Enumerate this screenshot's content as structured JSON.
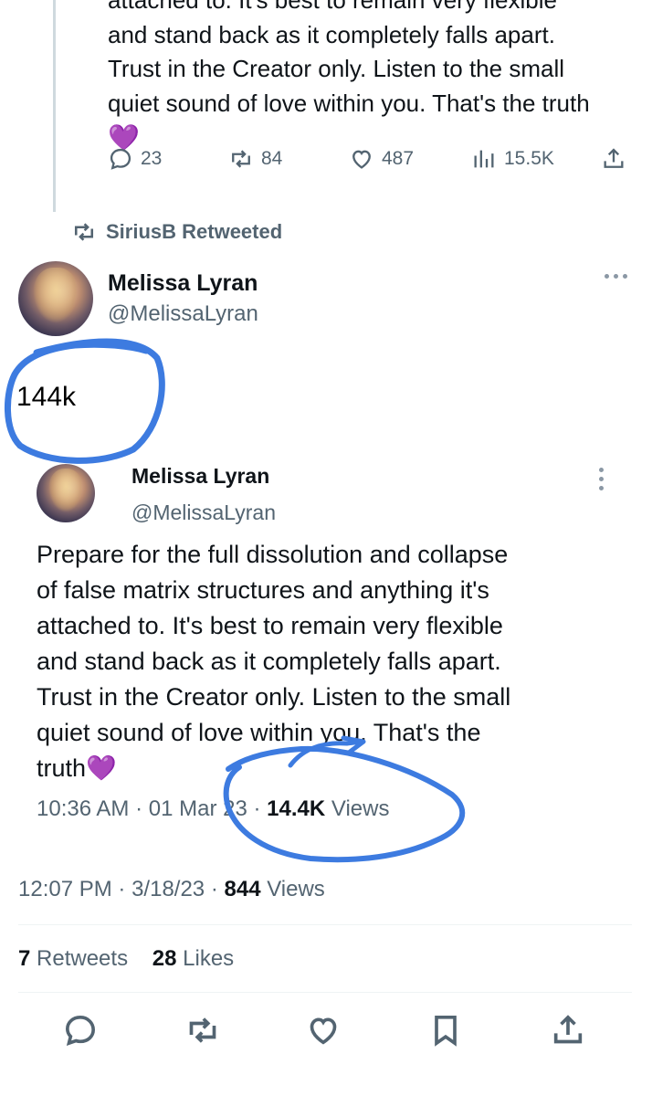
{
  "previous_tweet": {
    "lines": [
      "attached to. It's best to remain very flexible",
      "and stand back as it completely falls apart.",
      "Trust in the Creator only. Listen to the small",
      "quiet sound of love within you. That's the truth"
    ],
    "emoji": "💜",
    "actions": {
      "replies": "23",
      "retweets": "84",
      "likes": "487",
      "views": "15.5K"
    }
  },
  "retweet_banner": {
    "label": "SiriusB Retweeted"
  },
  "main_tweet": {
    "author_name": "Melissa Lyran",
    "author_handle": "@MelissaLyran",
    "circled_text": "144k",
    "quoted": {
      "author_name": "Melissa Lyran",
      "author_handle": "@MelissaLyran",
      "lines": [
        "Prepare for the full dissolution and collapse",
        "of false matrix structures and anything it's",
        "attached to. It's best to remain very flexible",
        "and stand back as it completely falls apart.",
        "Trust in the Creator only. Listen to the small",
        "quiet sound of love within you. That's the",
        "truth💜"
      ],
      "time": "10:36 AM",
      "date": "01 Mar 23",
      "views_count": "14.4K",
      "views_label": "Views"
    },
    "time": "12:07 PM",
    "date": "3/18/23",
    "views_count": "844",
    "views_label": "Views",
    "retweets_count": "7",
    "retweets_label": "Retweets",
    "likes_count": "28",
    "likes_label": "Likes"
  },
  "colors": {
    "annotation_blue": "#3d7be0",
    "secondary_text": "#536471",
    "emoji_purple": "#8e44d8"
  },
  "icons": [
    "reply-icon",
    "retweet-icon",
    "like-icon",
    "views-icon",
    "share-icon",
    "bookmark-icon",
    "more-icon"
  ]
}
